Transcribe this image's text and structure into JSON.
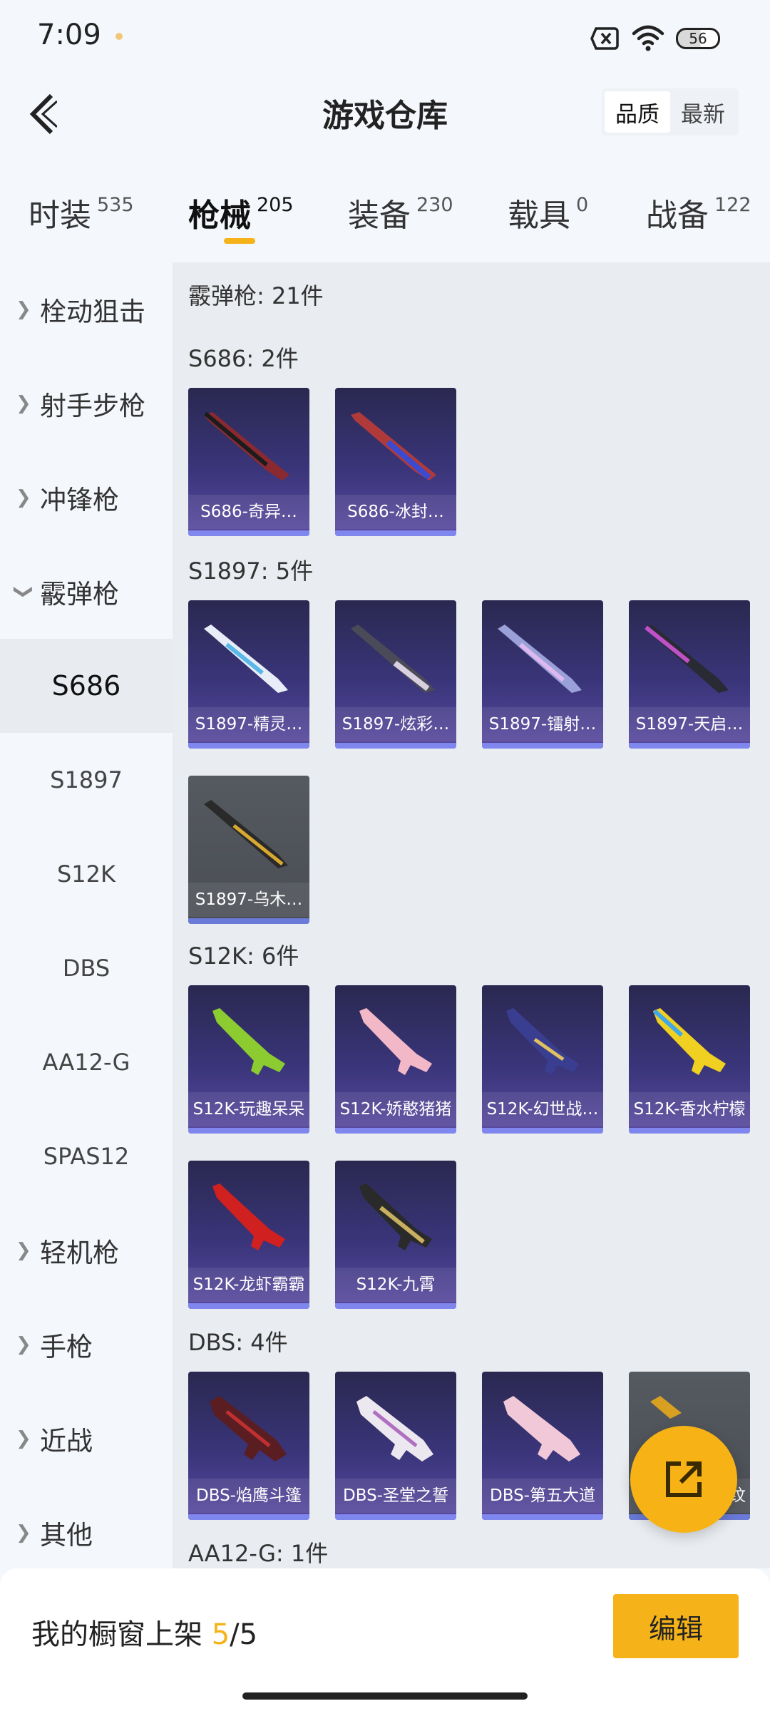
{
  "status": {
    "time": "7:09",
    "battery": "56"
  },
  "header": {
    "title": "游戏仓库",
    "sort_quality": "品质",
    "sort_latest": "最新"
  },
  "tabs": [
    {
      "label": "时装",
      "count": "535"
    },
    {
      "label": "枪械",
      "count": "205"
    },
    {
      "label": "装备",
      "count": "230"
    },
    {
      "label": "载具",
      "count": "0"
    },
    {
      "label": "战备",
      "count": "122"
    }
  ],
  "sidebar": {
    "cat_bolt": "栓动狙击",
    "cat_marksman": "射手步枪",
    "cat_smg": "冲锋枪",
    "cat_shotgun": "霰弹枪",
    "sub_s686": "S686",
    "sub_s1897": "S1897",
    "sub_s12k": "S12K",
    "sub_dbs": "DBS",
    "sub_aa12g": "AA12-G",
    "sub_spas12": "SPAS12",
    "cat_lmg": "轻机枪",
    "cat_pistol": "手枪",
    "cat_melee": "近战",
    "cat_other": "其他"
  },
  "content": {
    "category_header": "霰弹枪: 21件",
    "sections": {
      "s686": "S686: 2件",
      "s1897": "S1897: 5件",
      "s12k": "S12K: 6件",
      "dbs": "DBS: 4件",
      "aa12g": "AA12-G: 1件"
    },
    "items": {
      "s686_1": "S686-奇异…",
      "s686_2": "S686-冰封…",
      "s1897_1": "S1897-精灵…",
      "s1897_2": "S1897-炫彩…",
      "s1897_3": "S1897-镭射…",
      "s1897_4": "S1897-天启…",
      "s1897_5": "S1897-乌木…",
      "s12k_1": "S12K-玩趣呆呆",
      "s12k_2": "S12K-娇憨猪猪",
      "s12k_3": "S12K-幻世战…",
      "s12k_4": "S12K-香水柠檬",
      "s12k_5": "S12K-龙虾霸霸",
      "s12k_6": "S12K-九霄",
      "dbs_1": "DBS-焰鹰斗篷",
      "dbs_2": "DBS-圣堂之誓",
      "dbs_3": "DBS-第五大道",
      "dbs_4": "纹"
    }
  },
  "bottom": {
    "showcase_label": "我的橱窗上架",
    "showcase_current": "5",
    "showcase_total": "/5",
    "edit_label": "编辑"
  },
  "colors": {
    "accent": "#f5b319",
    "card_bg": "#3a357a",
    "card_bar": "#7f86ee"
  }
}
